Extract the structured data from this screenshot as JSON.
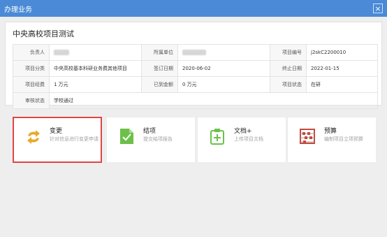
{
  "dialog": {
    "title": "办理业务",
    "close_glyph": "×"
  },
  "project": {
    "title": "中央高校项目测试",
    "rows": [
      [
        {
          "label": "负责人",
          "value": ""
        },
        {
          "label": "所属单位",
          "value": ""
        },
        {
          "label": "项目编号",
          "value": "j2skC2200010"
        }
      ],
      [
        {
          "label": "项目分类",
          "value": "中央高校基本科研业务费其他项目"
        },
        {
          "label": "签订日期",
          "value": "2020-06-02"
        },
        {
          "label": "终止日期",
          "value": "2022-01-15"
        }
      ],
      [
        {
          "label": "项目经费",
          "value": "1 万元"
        },
        {
          "label": "已到金额",
          "value": "0 万元"
        },
        {
          "label": "项目状态",
          "value": "在研"
        }
      ],
      [
        {
          "label": "审核状态",
          "value": "学校通过"
        }
      ]
    ]
  },
  "actions": [
    {
      "name": "变更",
      "desc": "针对信息进行变更申请",
      "icon": "refresh-arrows-icon",
      "color": "#e8a92c",
      "selected": true
    },
    {
      "name": "结项",
      "desc": "提交结项报告",
      "icon": "document-check-icon",
      "color": "#6cc04a",
      "selected": false
    },
    {
      "name": "文档+",
      "desc": "上传项目文档",
      "icon": "clipboard-plus-icon",
      "color": "#6cc04a",
      "selected": false
    },
    {
      "name": "预算",
      "desc": "编制项目立项预算",
      "icon": "abacus-icon",
      "color": "#c84a3c",
      "selected": false
    }
  ]
}
